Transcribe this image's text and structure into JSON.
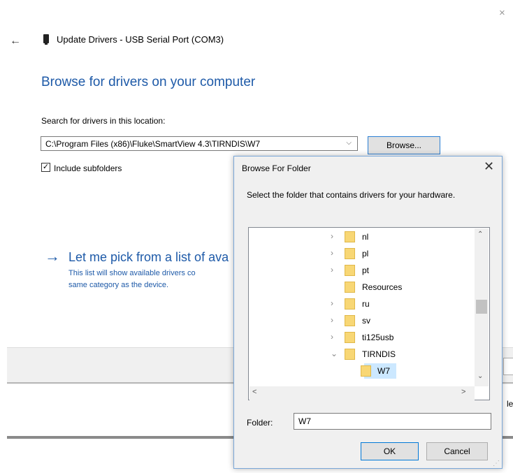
{
  "wizard": {
    "close_icon": "×",
    "back_icon": "←",
    "title": "Update Drivers - USB Serial Port (COM3)",
    "heading": "Browse for drivers on your computer",
    "search_label": "Search for drivers in this location:",
    "path_value": "C:\\Program Files (x86)\\Fluke\\SmartView 4.3\\TIRNDIS\\W7",
    "browse_label": "Browse...",
    "include_subfolders_label": "Include subfolders",
    "include_subfolders_checked": true,
    "pick_arrow": "→",
    "pick_title": "Let me pick from a list of ava",
    "pick_desc": "This list will show available drivers co\nsame category as the device.",
    "partial_text": "le"
  },
  "dialog": {
    "title": "Browse For Folder",
    "close_icon": "✕",
    "description": "Select the folder that contains drivers for your hardware.",
    "tree_items": [
      {
        "label": "nl",
        "chevron": "›"
      },
      {
        "label": "pl",
        "chevron": "›"
      },
      {
        "label": "pt",
        "chevron": "›"
      },
      {
        "label": "Resources",
        "chevron": ""
      },
      {
        "label": "ru",
        "chevron": "›"
      },
      {
        "label": "sv",
        "chevron": "›"
      },
      {
        "label": "ti125usb",
        "chevron": "›"
      },
      {
        "label": "TIRNDIS",
        "chevron": "⌄"
      },
      {
        "label": "W7",
        "chevron": ""
      }
    ],
    "folder_label": "Folder:",
    "folder_value": "W7",
    "ok_label": "OK",
    "cancel_label": "Cancel"
  },
  "colors": {
    "accent": "#1e5aa8",
    "folder": "#f8d775",
    "selection": "#cce8ff"
  }
}
